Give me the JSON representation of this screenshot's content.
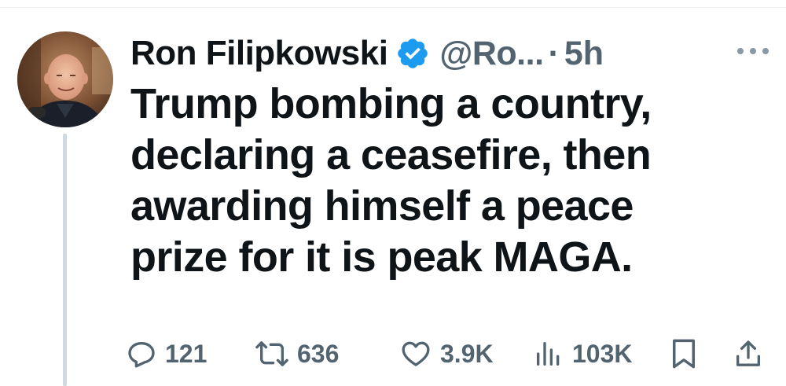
{
  "tweet": {
    "author": {
      "display_name": "Ron Filipkowski",
      "handle": "@Ro...",
      "verified": true,
      "avatar_icon": "avatar-photo"
    },
    "separator": "·",
    "time": "5h",
    "text_lines": [
      "Trump bombing a country,",
      "declaring a ceasefire, then",
      "awarding himself a peace",
      "prize for it is peak MAGA."
    ]
  },
  "actions": {
    "replies": {
      "icon": "reply-icon",
      "count": "121"
    },
    "reposts": {
      "icon": "repost-icon",
      "count": "636"
    },
    "likes": {
      "icon": "heart-icon",
      "count": "3.9K"
    },
    "views": {
      "icon": "views-icon",
      "count": "103K"
    },
    "bookmark": {
      "icon": "bookmark-icon"
    },
    "share": {
      "icon": "share-icon"
    }
  },
  "colors": {
    "text": "#0f1419",
    "secondary": "#536471",
    "verified": "#1d9bf0",
    "thread_line": "#cfd9de"
  }
}
